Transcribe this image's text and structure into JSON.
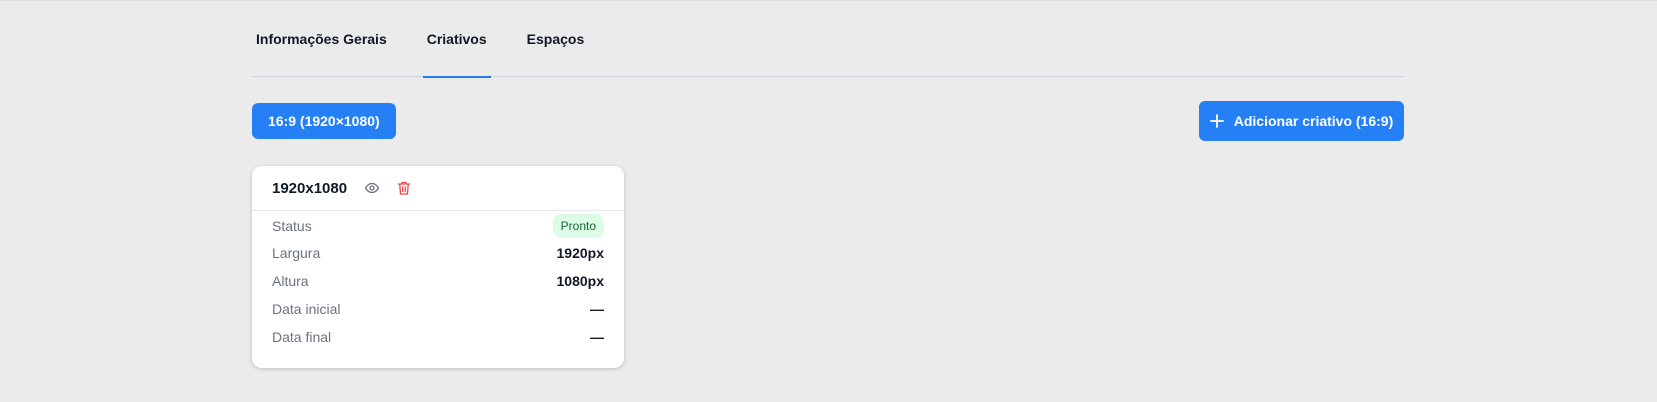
{
  "tabs": [
    {
      "label": "Informações Gerais",
      "active": false
    },
    {
      "label": "Criativos",
      "active": true
    },
    {
      "label": "Espaços",
      "active": false
    }
  ],
  "toolbar": {
    "ratio_chip": "16:9 (1920×1080)",
    "add_button": "Adicionar criativo (16:9)",
    "add_icon": "plus-icon"
  },
  "card": {
    "title": "1920x1080",
    "view_icon": "eye-icon",
    "delete_icon": "trash-icon",
    "rows": [
      {
        "label": "Status",
        "value": "Pronto"
      },
      {
        "label": "Largura",
        "value": "1920px"
      },
      {
        "label": "Altura",
        "value": "1080px"
      },
      {
        "label": "Data inicial",
        "value": "—"
      },
      {
        "label": "Data final",
        "value": "—"
      }
    ]
  },
  "colors": {
    "accent": "#2680f5",
    "background": "#ebebeb",
    "delete": "#ef4444",
    "status_badge_bg": "#dcfce7",
    "status_badge_text": "#166534"
  }
}
